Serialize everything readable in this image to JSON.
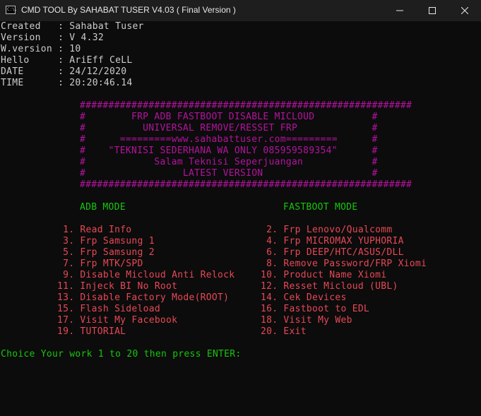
{
  "window": {
    "icon_text": "C:\\.",
    "title": "CMD TOOL By SAHABAT TUSER V4.03 ( Final Version )"
  },
  "info": [
    "Created   : Sahabat Tuser",
    "Version   : V 4.32",
    "W.version : 10",
    "Hello     : AriEff CeLL",
    "DATE      : 24/12/2020",
    "TIME      : 20:20:46.14"
  ],
  "banner": [
    "##########################################################",
    "#        FRP ADB FASTBOOT DISABLE MICLOUD          #",
    "#          UNIVERSAL REMOVE/RESSET FRP             #",
    "#      =========www.sahabattuser.com=========      #",
    "#    \"TEKNISI SEDERHANA WA ONLY 085959589354\"      #",
    "#            Salam Teknisi Seperjuangan            #",
    "#                 LATEST VERSION                   #",
    "##########################################################"
  ],
  "modes": {
    "adb_title": "ADB MODE",
    "fastboot_title": "FASTBOOT MODE"
  },
  "menu_left": [
    " 1. Read Info",
    " 3. Frp Samsung 1",
    " 5. Frp Samsung 2",
    " 7. Frp MTK/SPD",
    " 9. Disable Micloud Anti Relock",
    "11. Injeck BI No Root",
    "13. Disable Factory Mode(ROOT)",
    "15. Flash Sideload",
    "17. Visit My Facebook",
    "19. TUTORIAL"
  ],
  "menu_right": [
    " 2. Frp Lenovo/Qualcomm",
    " 4. Frp MICROMAX YUPHORIA",
    " 6. Frp DEEP/HTC/ASUS/DLL",
    " 8. Remove Password/FRP Xiomi",
    "10. Product Name Xiomi",
    "12. Resset Micloud (UBL)",
    "14. Cek Devices",
    "16. Fastboot to EDL",
    "18. Visit My Web",
    "20. Exit"
  ],
  "prompt": "Choice Your work 1 to 20 then press ENTER:",
  "colors": {
    "background": "#0c0c0c",
    "text": "#cccccc",
    "banner": "#b4139e",
    "mode_title": "#16c60c",
    "menu_number": "#e74856",
    "prompt": "#16c60c"
  }
}
